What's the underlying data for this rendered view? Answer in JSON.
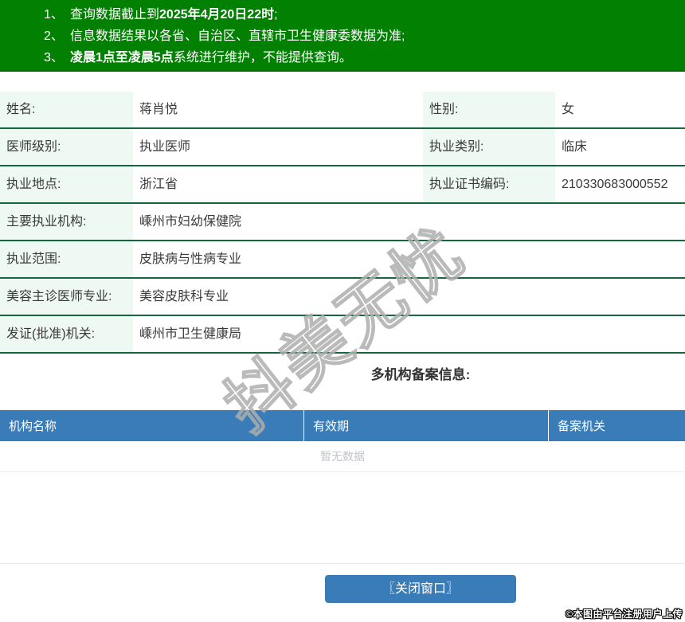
{
  "notices": {
    "items": [
      {
        "num": "1、",
        "pre": "查询数据截止到",
        "bold": "2025年4月20日22时",
        "post": ";"
      },
      {
        "num": "2、",
        "pre": "信息数据结果以各省、自治区、直辖市卫生健康委数据为准;",
        "bold": "",
        "post": ""
      },
      {
        "num": "3、",
        "pre": "",
        "bold": "凌晨1点至凌晨5点",
        "post": "系统进行维护，不能提供查询。"
      }
    ]
  },
  "profile": {
    "rows": [
      {
        "label": "姓名:",
        "value": "蒋肖悦",
        "label2": "性别:",
        "value2": "女"
      },
      {
        "label": "医师级别:",
        "value": "执业医师",
        "label2": "执业类别:",
        "value2": "临床"
      },
      {
        "label": "执业地点:",
        "value": "浙江省",
        "label2": "执业证书编码:",
        "value2": "210330683000552"
      },
      {
        "label": "主要执业机构:",
        "value": "嵊州市妇幼保健院"
      },
      {
        "label": "执业范围:",
        "value": "皮肤病与性病专业"
      },
      {
        "label": "美容主诊医师专业:",
        "value": "美容皮肤科专业"
      },
      {
        "label": "发证(批准)机关:",
        "value": "嵊州市卫生健康局"
      }
    ]
  },
  "multi_org": {
    "title": "多机构备案信息:",
    "columns": [
      "机构名称",
      "有效期",
      "备案机关"
    ],
    "empty_text": "暂无数据"
  },
  "close_button": {
    "label": "〖关闭窗口〗"
  },
  "footer": {
    "credit": "©本图由平台注册用户上传"
  },
  "watermark": {
    "text": "抖美无忧"
  },
  "colors": {
    "banner_green": "#028002",
    "row_border_green": "#14683c",
    "label_cell_bg": "#edf9f2",
    "table_header_blue": "#3a7cb8",
    "button_blue": "#3a7cb8",
    "empty_text_gray": "#bfc3cb"
  }
}
